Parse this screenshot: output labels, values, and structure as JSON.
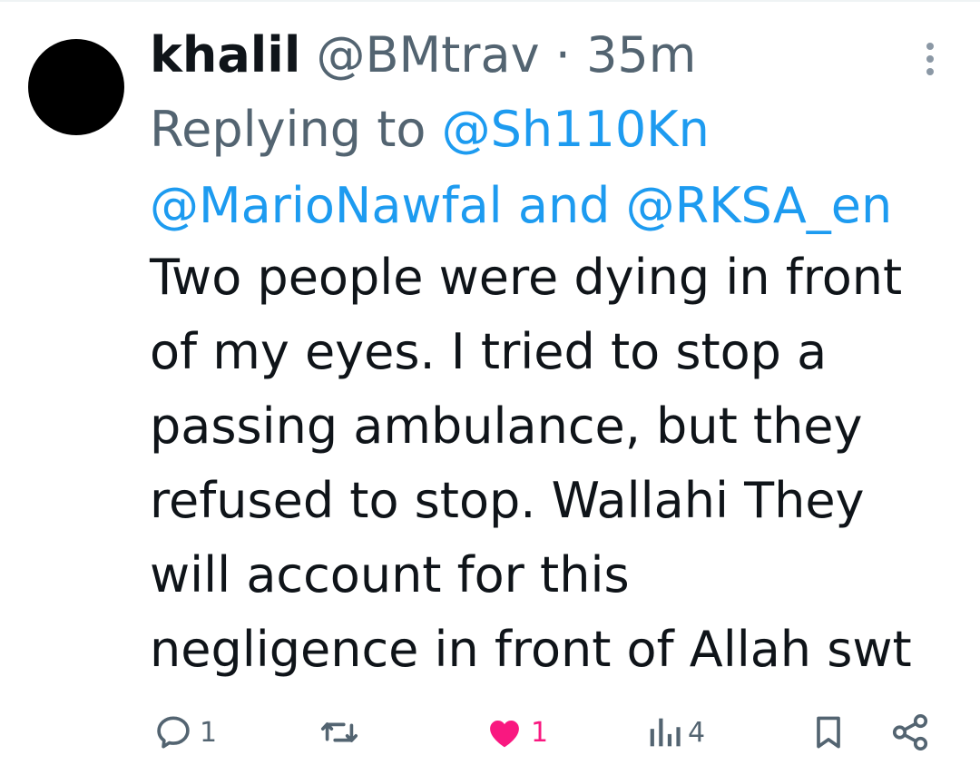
{
  "tweet": {
    "display_name": "khalil",
    "handle": "@BMtrav",
    "separator": "·",
    "time": "35m",
    "replying_prefix": "Replying to",
    "reply_mentions": [
      "@Sh110Kn",
      "@MarioNawfal",
      "@RKSA_en"
    ],
    "reply_and": "and",
    "body_lines": [
      "Two people were dying in front",
      "of my eyes. I tried to stop a",
      "passing ambulance, but they",
      "refused to stop. Wallahi They",
      "will account for this",
      "negligence in front of Allah swt"
    ]
  },
  "actions": {
    "reply": {
      "icon": "reply-icon",
      "count": "1"
    },
    "retweet": {
      "icon": "retweet-icon",
      "count": ""
    },
    "like": {
      "icon": "heart-icon",
      "count": "1",
      "liked": true
    },
    "views": {
      "icon": "views-icon",
      "count": "4"
    },
    "bookmark": {
      "icon": "bookmark-icon"
    },
    "share": {
      "icon": "share-icon"
    }
  },
  "colors": {
    "text": "#0f1419",
    "secondary": "#536471",
    "link": "#1d9bf0",
    "like": "#f91880"
  }
}
